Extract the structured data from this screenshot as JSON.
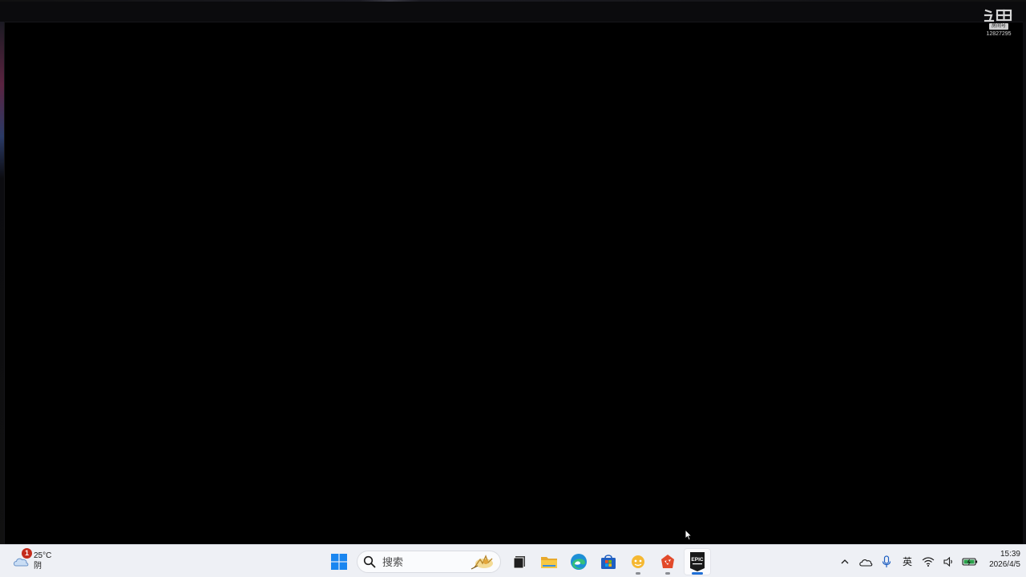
{
  "watermark": {
    "badge": "房间号",
    "room_id": "12827295"
  },
  "taskbar": {
    "weather": {
      "icon": "cloudy-weather-icon",
      "notification_count": "1",
      "temperature": "25°C",
      "condition": "阴"
    },
    "start_icon": "windows-start-icon",
    "search": {
      "placeholder": "搜索",
      "icon": "search-icon"
    },
    "apps": [
      {
        "name": "task-view",
        "icon": "task-view-icon",
        "running": false
      },
      {
        "name": "file-explorer",
        "icon": "folder-icon",
        "running": false
      },
      {
        "name": "edge",
        "icon": "edge-browser-icon",
        "running": false
      },
      {
        "name": "microsoft-store",
        "icon": "store-icon",
        "running": false
      },
      {
        "name": "chat-app",
        "icon": "chat-app-icon",
        "running": true
      },
      {
        "name": "game-launcher",
        "icon": "game-launcher-icon",
        "running": true
      },
      {
        "name": "epic-games",
        "icon": "epic-games-icon",
        "running": true,
        "active": true
      }
    ],
    "epic_label": "EPIC",
    "tray": {
      "language": "英",
      "icons": [
        "chevron-up-icon",
        "cloud-icon",
        "microphone-icon",
        "wifi-icon",
        "volume-icon",
        "battery-icon"
      ]
    },
    "clock": {
      "time": "15:39",
      "date": "2026/4/5"
    }
  },
  "colors": {
    "taskbar_bg": "#eef0f5",
    "accent": "#1f6fd6",
    "badge": "#c42b1c",
    "screen_bg": "#000000"
  }
}
